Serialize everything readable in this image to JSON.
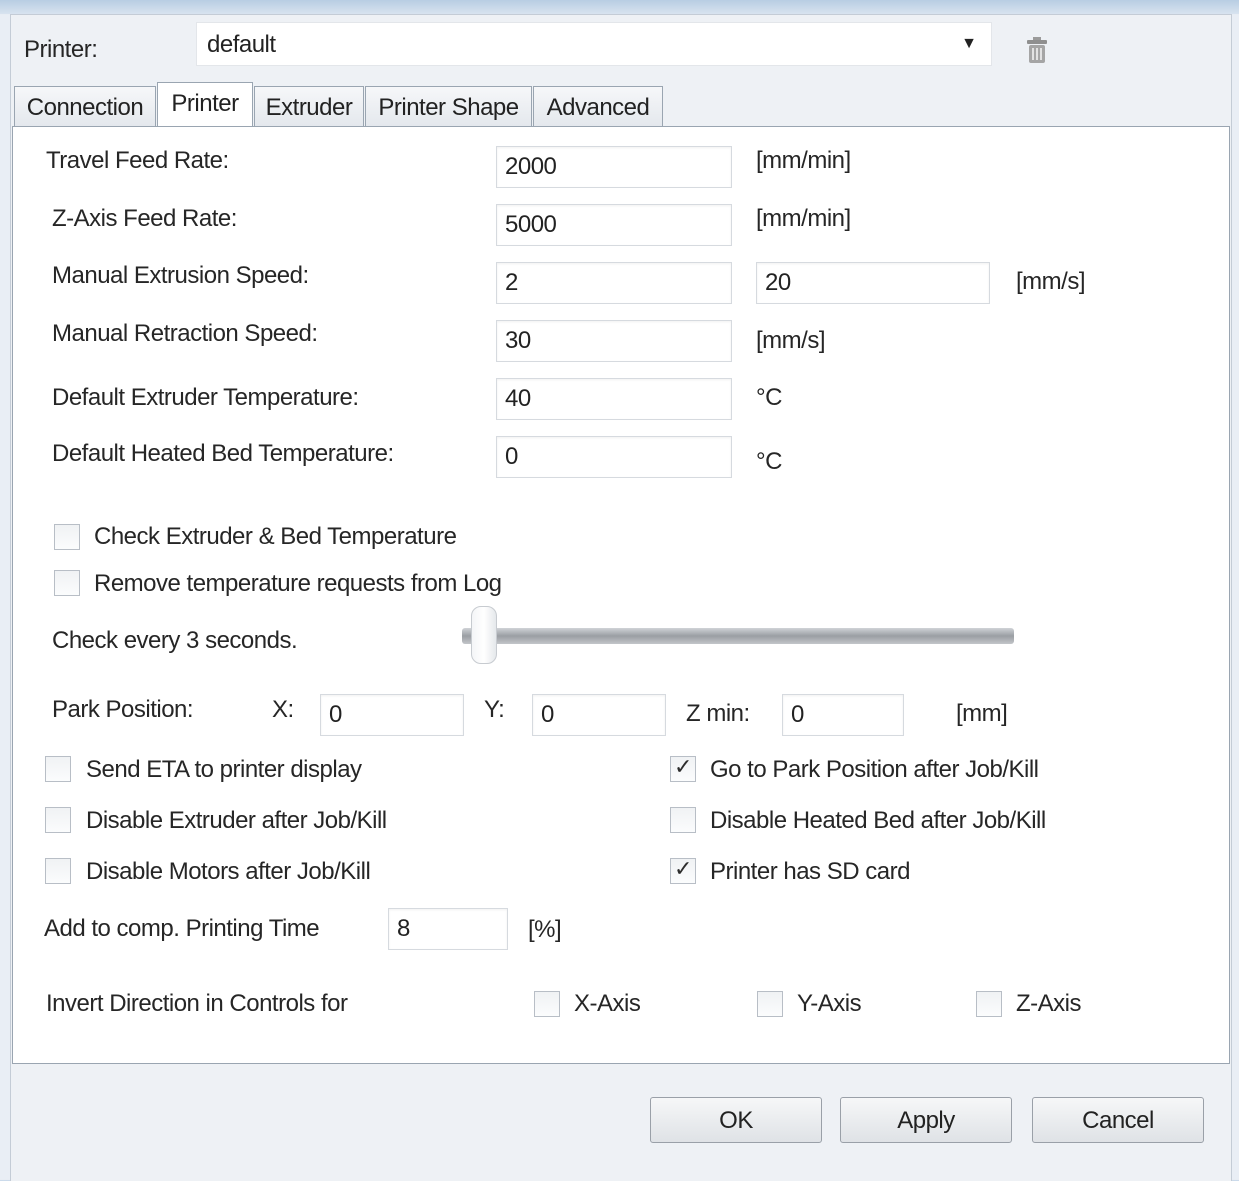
{
  "printer": {
    "label": "Printer:",
    "selected": "default"
  },
  "tabs": [
    {
      "label": "Connection"
    },
    {
      "label": "Printer"
    },
    {
      "label": "Extruder"
    },
    {
      "label": "Printer Shape"
    },
    {
      "label": "Advanced"
    }
  ],
  "settings": {
    "travel_feed_rate": {
      "label": "Travel Feed Rate:",
      "value": "2000",
      "unit": "[mm/min]"
    },
    "z_axis_feed_rate": {
      "label": "Z-Axis Feed Rate:",
      "value": "5000",
      "unit": "[mm/min]"
    },
    "manual_extrusion_speed": {
      "label": "Manual Extrusion Speed:",
      "value": "2",
      "value2": "20",
      "unit": "[mm/s]"
    },
    "manual_retraction_speed": {
      "label": "Manual Retraction Speed:",
      "value": "30",
      "unit": "[mm/s]"
    },
    "default_extruder_temp": {
      "label": "Default Extruder Temperature:",
      "value": "40",
      "unit": "°C"
    },
    "default_bed_temp": {
      "label": "Default Heated Bed Temperature:",
      "value": "0",
      "unit": "°C"
    }
  },
  "checks": {
    "check_temp": {
      "label": "Check Extruder & Bed Temperature",
      "checked": false
    },
    "remove_temp_requests": {
      "label": "Remove temperature requests from Log",
      "checked": false
    },
    "send_eta": {
      "label": "Send ETA to printer display",
      "checked": false
    },
    "go_to_park": {
      "label": "Go to Park Position after Job/Kill",
      "checked": true
    },
    "disable_extruder": {
      "label": "Disable Extruder after Job/Kill",
      "checked": false
    },
    "disable_bed": {
      "label": "Disable Heated Bed after Job/Kill",
      "checked": false
    },
    "disable_motors": {
      "label": "Disable Motors after Job/Kill",
      "checked": false
    },
    "sd_card": {
      "label": "Printer has SD card",
      "checked": true
    }
  },
  "check_interval": {
    "label": "Check every 3 seconds.",
    "value": 3
  },
  "park": {
    "label": "Park Position:",
    "x_label": "X:",
    "x": "0",
    "y_label": "Y:",
    "y": "0",
    "z_label": "Z min:",
    "z": "0",
    "unit": "[mm]"
  },
  "print_time": {
    "label": "Add to comp. Printing Time",
    "value": "8",
    "unit": "[%]"
  },
  "invert": {
    "label": "Invert Direction in Controls for",
    "x_axis": {
      "label": "X-Axis",
      "checked": false
    },
    "y_axis": {
      "label": "Y-Axis",
      "checked": false
    },
    "z_axis": {
      "label": "Z-Axis",
      "checked": false
    }
  },
  "buttons": {
    "ok": "OK",
    "apply": "Apply",
    "cancel": "Cancel"
  },
  "icons": {
    "dropdown": "chevron-down-icon",
    "delete": "trash-icon",
    "check": "checkmark-icon"
  }
}
